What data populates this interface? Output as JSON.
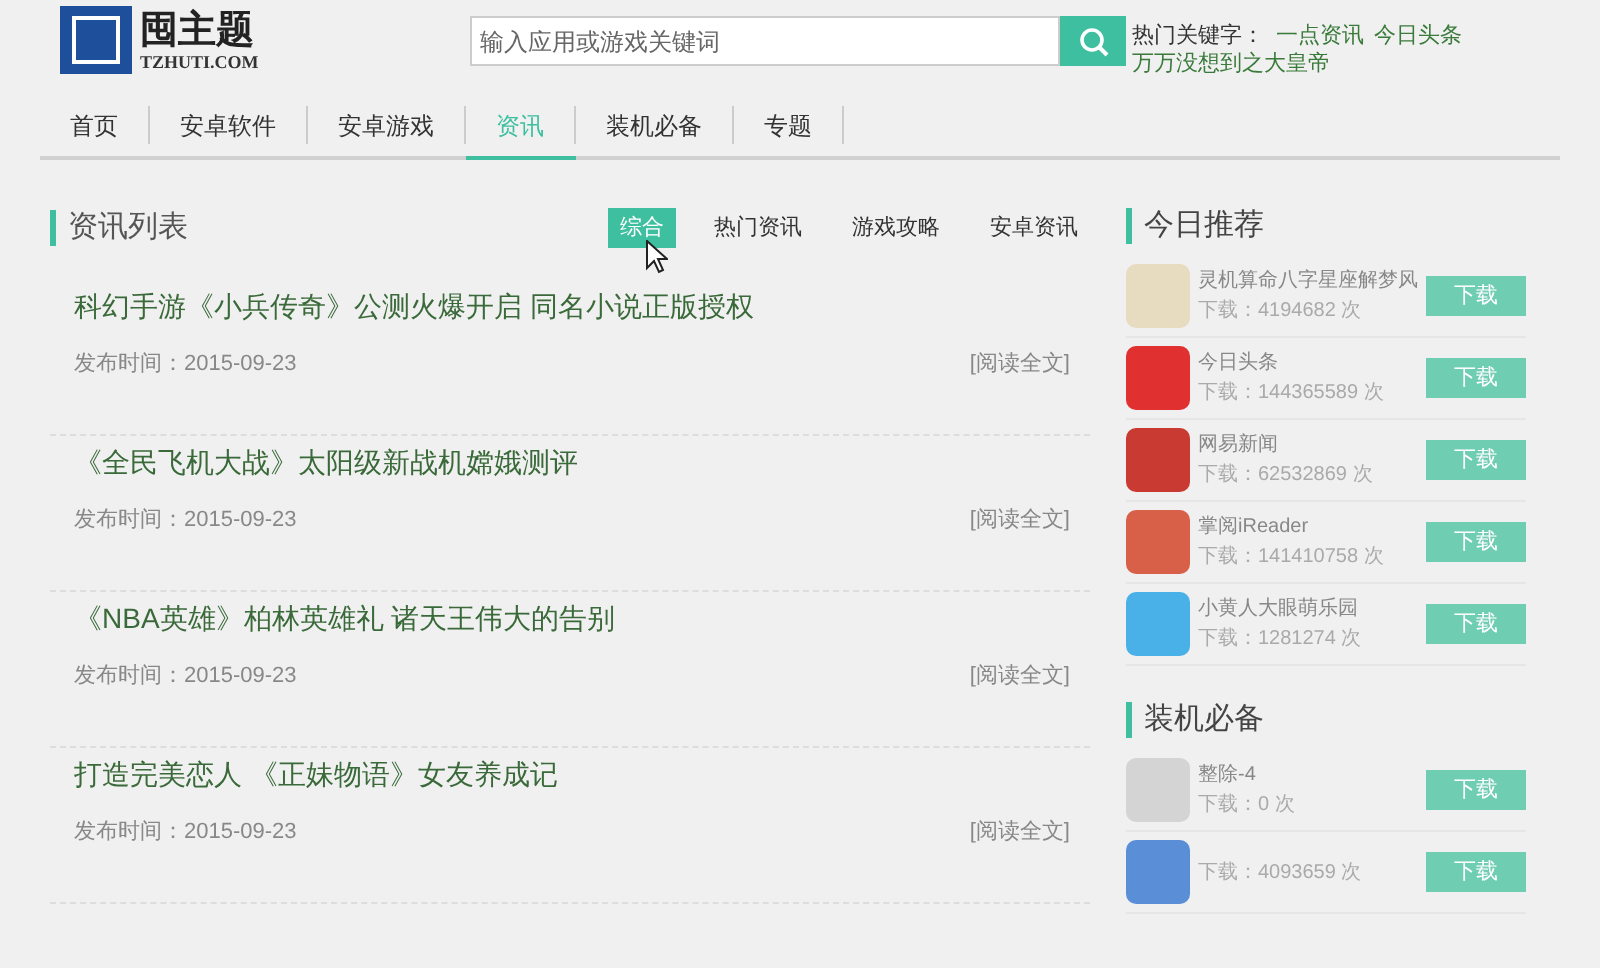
{
  "logo": {
    "title": "囤主题",
    "subtitle": "TZHUTI.COM"
  },
  "search": {
    "placeholder": "输入应用或游戏关键词"
  },
  "hot_keywords": {
    "label": "热门关键字：",
    "items": [
      "一点资讯",
      "今日头条",
      "万万没想到之大皇帝"
    ]
  },
  "nav": [
    {
      "label": "首页",
      "selected": false
    },
    {
      "label": "安卓软件",
      "selected": false
    },
    {
      "label": "安卓游戏",
      "selected": false
    },
    {
      "label": "资讯",
      "selected": true
    },
    {
      "label": "装机必备",
      "selected": false
    },
    {
      "label": "专题",
      "selected": false
    }
  ],
  "news": {
    "title": "资讯列表",
    "filters": [
      {
        "label": "综合",
        "selected": true
      },
      {
        "label": "热门资讯",
        "selected": false
      },
      {
        "label": "游戏攻略",
        "selected": false
      },
      {
        "label": "安卓资讯",
        "selected": false
      }
    ],
    "articles": [
      {
        "title": "科幻手游《小兵传奇》公测火爆开启 同名小说正版授权",
        "date": "发布时间：2015-09-23",
        "link": "[阅读全文]"
      },
      {
        "title": "《全民飞机大战》太阳级新战机嫦娥测评",
        "date": "发布时间：2015-09-23",
        "link": "[阅读全文]"
      },
      {
        "title": "《NBA英雄》柏林英雄礼 诸天王伟大的告别",
        "date": "发布时间：2015-09-23",
        "link": "[阅读全文]"
      },
      {
        "title": "打造完美恋人 《正妹物语》女友养成记",
        "date": "发布时间：2015-09-23",
        "link": "[阅读全文]"
      }
    ]
  },
  "today": {
    "title": "今日推荐",
    "apps": [
      {
        "name": "灵机算命八字星座解梦风",
        "downloads": "下载：4194682 次",
        "button": "下载",
        "color": "#e8dcc0"
      },
      {
        "name": "今日头条",
        "downloads": "下载：144365589 次",
        "button": "下载",
        "color": "#e03030"
      },
      {
        "name": "网易新闻",
        "downloads": "下载：62532869 次",
        "button": "下载",
        "color": "#c83a32"
      },
      {
        "name": "掌阅iReader",
        "downloads": "下载：141410758 次",
        "button": "下载",
        "color": "#d86048"
      },
      {
        "name": "小黄人大眼萌乐园",
        "downloads": "下载：1281274 次",
        "button": "下载",
        "color": "#4ab0e8"
      }
    ]
  },
  "essentials": {
    "title": "装机必备",
    "apps": [
      {
        "name": "整除-4",
        "downloads": "下载：0 次",
        "button": "下载",
        "color": "#d4d4d4"
      },
      {
        "downloads": "下载：4093659 次",
        "button": "下载",
        "color": "#5a8fd8"
      }
    ]
  }
}
